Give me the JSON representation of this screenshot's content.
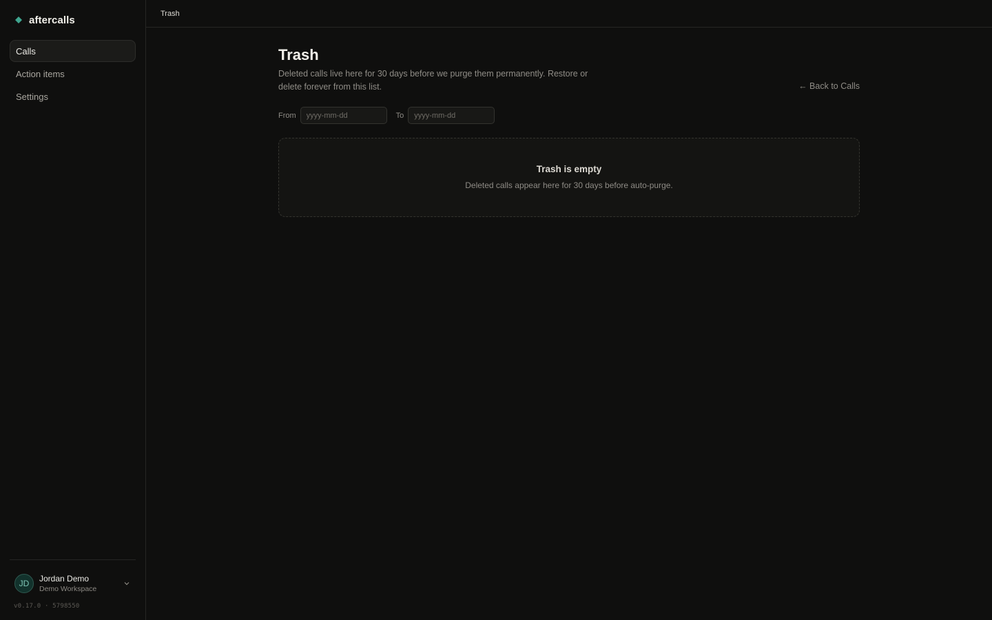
{
  "brand": {
    "name": "aftercalls",
    "icon": "brand-diamond-icon",
    "accent": "#3fa58f"
  },
  "sidebar": {
    "items": [
      {
        "label": "Calls",
        "active": true
      },
      {
        "label": "Action items",
        "active": false
      },
      {
        "label": "Settings",
        "active": false
      }
    ]
  },
  "user": {
    "initials": "JD",
    "name": "Jordan Demo",
    "workspace": "Demo Workspace",
    "menu_icon": "chevron-down-icon"
  },
  "version": "v0.17.0 · 5798550",
  "topbar": {
    "breadcrumb": "Trash"
  },
  "page": {
    "title": "Trash",
    "description": "Deleted calls live here for 30 days before we purge them permanently. Restore or delete forever from this list.",
    "back_link": "← Back to Calls"
  },
  "filters": {
    "from_label": "From",
    "from_value": "",
    "from_placeholder": "yyyy-mm-dd",
    "to_label": "To",
    "to_value": "",
    "to_placeholder": "yyyy-mm-dd"
  },
  "empty_state": {
    "title": "Trash is empty",
    "subtitle": "Deleted calls appear here for 30 days before auto-purge."
  }
}
